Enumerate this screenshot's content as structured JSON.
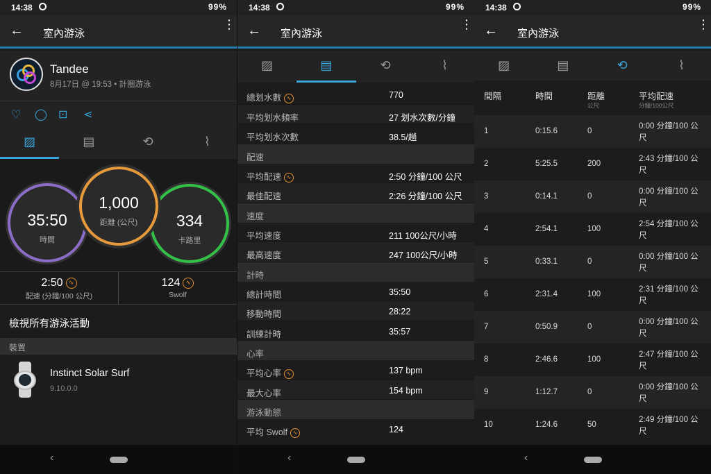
{
  "status": {
    "time": "14:38",
    "battery": "99%"
  },
  "panel1": {
    "title": "室內游泳",
    "profile": {
      "name": "Tandee",
      "meta": "8月17日 @ 19:53 • 計圈游泳"
    },
    "rings": {
      "time": {
        "value": "35:50",
        "label": "時間"
      },
      "distance": {
        "value": "1,000",
        "label": "距離 (公尺)"
      },
      "calories": {
        "value": "334",
        "label": "卡路里"
      }
    },
    "stats": [
      {
        "value": "2:50",
        "label": "配速 (分鐘/100 公尺)"
      },
      {
        "value": "124",
        "label": "Swolf"
      }
    ],
    "view_all": "檢視所有游泳活動",
    "section_device": "裝置",
    "device": {
      "name": "Instinct Solar Surf",
      "version": "9.10.0.0"
    }
  },
  "panel2": {
    "title": "室內游泳",
    "rows": [
      {
        "type": "row",
        "key": "總划水數",
        "value": "770",
        "icon": true
      },
      {
        "type": "row",
        "key": "平均划水頻率",
        "value": "27 划水次數/分鐘"
      },
      {
        "type": "row",
        "key": "平均划水次數",
        "value": "38.5/趟"
      },
      {
        "type": "header",
        "key": "配速"
      },
      {
        "type": "row",
        "key": "平均配速",
        "value": "2:50 分鐘/100 公尺",
        "icon": true
      },
      {
        "type": "row",
        "key": "最佳配速",
        "value": "2:26 分鐘/100 公尺"
      },
      {
        "type": "header",
        "key": "速度"
      },
      {
        "type": "row",
        "key": "平均速度",
        "value": "211 100公尺/小時"
      },
      {
        "type": "row",
        "key": "最高速度",
        "value": "247 100公尺/小時"
      },
      {
        "type": "header",
        "key": "計時"
      },
      {
        "type": "row",
        "key": "總計時間",
        "value": "35:50"
      },
      {
        "type": "row",
        "key": "移動時間",
        "value": "28:22"
      },
      {
        "type": "row",
        "key": "訓練計時",
        "value": "35:57"
      },
      {
        "type": "header",
        "key": "心率"
      },
      {
        "type": "row",
        "key": "平均心率",
        "value": "137 bpm",
        "icon": true
      },
      {
        "type": "row",
        "key": "最大心率",
        "value": "154 bpm"
      },
      {
        "type": "header",
        "key": "游泳動態"
      },
      {
        "type": "row",
        "key": "平均 Swolf",
        "value": "124",
        "icon": true
      }
    ]
  },
  "panel3": {
    "title": "室內游泳",
    "headers": {
      "lap": "間隔",
      "time": "時間",
      "dist": "距離",
      "dist_unit": "公尺",
      "pace": "平均配速",
      "pace_unit": "分鐘/100公尺"
    },
    "laps": [
      {
        "lap": "1",
        "time": "0:15.6",
        "dist": "0",
        "pace": "0:00 分鐘/100 公尺"
      },
      {
        "lap": "2",
        "time": "5:25.5",
        "dist": "200",
        "pace": "2:43 分鐘/100 公尺"
      },
      {
        "lap": "3",
        "time": "0:14.1",
        "dist": "0",
        "pace": "0:00 分鐘/100 公尺"
      },
      {
        "lap": "4",
        "time": "2:54.1",
        "dist": "100",
        "pace": "2:54 分鐘/100 公尺"
      },
      {
        "lap": "5",
        "time": "0:33.1",
        "dist": "0",
        "pace": "0:00 分鐘/100 公尺"
      },
      {
        "lap": "6",
        "time": "2:31.4",
        "dist": "100",
        "pace": "2:31 分鐘/100 公尺"
      },
      {
        "lap": "7",
        "time": "0:50.9",
        "dist": "0",
        "pace": "0:00 分鐘/100 公尺"
      },
      {
        "lap": "8",
        "time": "2:46.6",
        "dist": "100",
        "pace": "2:47 分鐘/100 公尺"
      },
      {
        "lap": "9",
        "time": "1:12.7",
        "dist": "0",
        "pace": "0:00 分鐘/100 公尺"
      },
      {
        "lap": "10",
        "time": "1:24.6",
        "dist": "50",
        "pace": "2:49 分鐘/100 公尺"
      }
    ]
  },
  "colors": {
    "accent": "#3aa3d8",
    "time_ring": "#8b6dc7",
    "distance_ring": "#e69a3c",
    "calories_ring": "#33c247",
    "warning": "#e68f2e"
  }
}
